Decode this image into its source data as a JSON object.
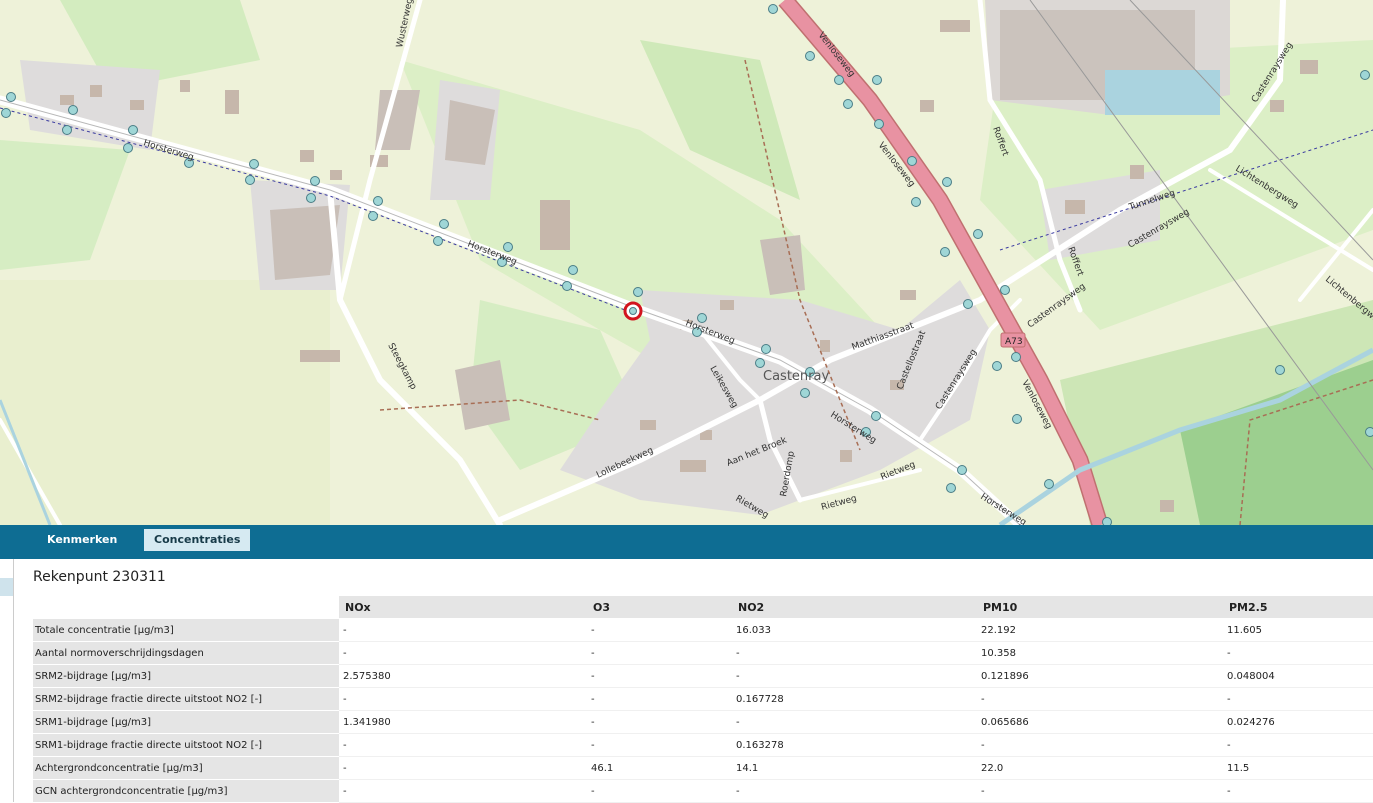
{
  "map": {
    "labels": {
      "horsterweg": "Horsterweg",
      "wusterweg": "Wusterweg",
      "venloseweg": "Venloseweg",
      "castenray": "Castenray",
      "roffert": "Roffert",
      "tunnelweg": "Tunnelweg",
      "castenraysweg": "Castenraysweg",
      "lichtenbergweg": "Lichtenbergweg",
      "steegkamp": "Steegkamp",
      "leikesweg": "Leikesweg",
      "lollebeekweg": "Lollebeekweg",
      "matthiasstraat": "Matthiasstraat",
      "castellostraat": "Castellostraat",
      "aan_het_broek": "Aan het Broek",
      "roerdomp": "Roerdomp",
      "rietweg": "Rietweg",
      "a73": "A73"
    }
  },
  "tabs": [
    {
      "label": "Kenmerken",
      "active": false
    },
    {
      "label": "Concentraties",
      "active": true
    }
  ],
  "panel": {
    "title": "Rekenpunt 230311",
    "columns": [
      "NOx",
      "O3",
      "NO2",
      "PM10",
      "PM2.5"
    ],
    "rows": [
      {
        "label": "Totale concentratie [µg/m3]",
        "values": [
          "-",
          "-",
          "16.033",
          "22.192",
          "11.605"
        ]
      },
      {
        "label": "Aantal normoverschrijdingsdagen",
        "values": [
          "-",
          "-",
          "-",
          "10.358",
          "-"
        ]
      },
      {
        "label": "SRM2-bijdrage [µg/m3]",
        "values": [
          "2.575380",
          "-",
          "-",
          "0.121896",
          "0.048004"
        ]
      },
      {
        "label": "SRM2-bijdrage fractie directe uitstoot NO2 [-]",
        "values": [
          "-",
          "-",
          "0.167728",
          "-",
          "-"
        ]
      },
      {
        "label": "SRM1-bijdrage [µg/m3]",
        "values": [
          "1.341980",
          "-",
          "-",
          "0.065686",
          "0.024276"
        ]
      },
      {
        "label": "SRM1-bijdrage fractie directe uitstoot NO2 [-]",
        "values": [
          "-",
          "-",
          "0.163278",
          "-",
          "-"
        ]
      },
      {
        "label": "Achtergrondconcentratie [µg/m3]",
        "values": [
          "-",
          "46.1",
          "14.1",
          "22.0",
          "11.5"
        ]
      },
      {
        "label": "GCN achtergrondconcentratie [µg/m3]",
        "values": [
          "-",
          "-",
          "-",
          "-",
          "-"
        ]
      }
    ]
  }
}
